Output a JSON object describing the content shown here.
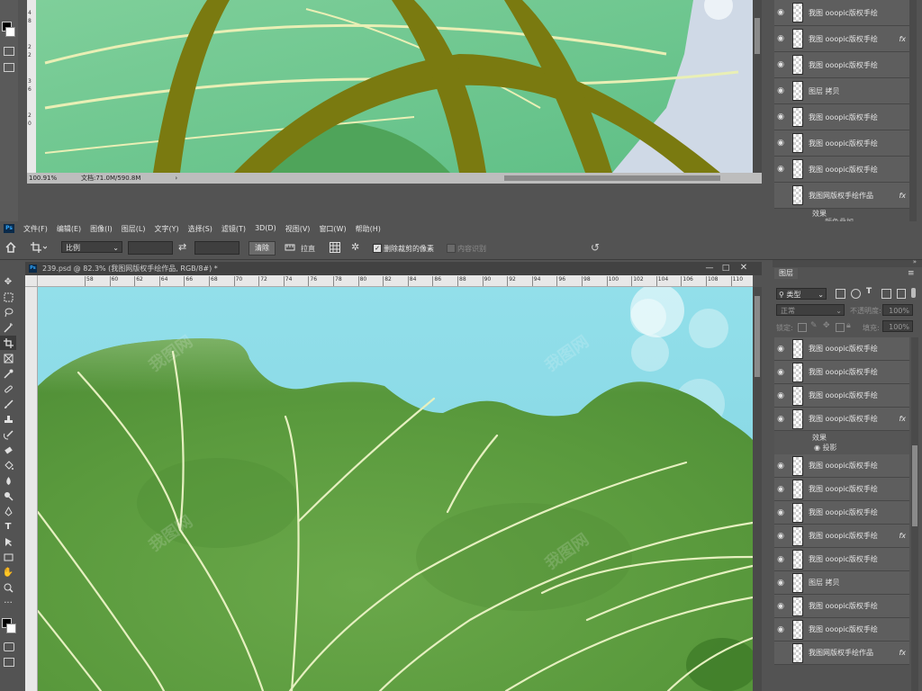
{
  "top_window": {
    "zoom": "100.91%",
    "doc_info": "文档:71.0M/590.8M",
    "ruler_marks": [
      "4",
      "8",
      "2",
      "2",
      "3",
      "6",
      "2",
      "0",
      "2",
      "4"
    ]
  },
  "menubar": {
    "ps_icon": "Ps",
    "items": [
      "文件(F)",
      "编辑(E)",
      "图像(I)",
      "图层(L)",
      "文字(Y)",
      "选择(S)",
      "滤镜(T)",
      "3D(D)",
      "视图(V)",
      "窗口(W)",
      "帮助(H)"
    ]
  },
  "options": {
    "ratio_value": "比例",
    "clear_button": "清除",
    "straighten": "拉直",
    "delete_cropped": "删除裁剪的像素",
    "content_aware": "内容识别"
  },
  "document": {
    "tab_title": "239.psd @ 82.3% (我图网版权手绘作品, RGB/8#) *",
    "ruler_h": [
      "58",
      "60",
      "62",
      "64",
      "66",
      "68",
      "70",
      "72",
      "74",
      "76",
      "78",
      "80",
      "82",
      "84",
      "86",
      "88",
      "90",
      "92",
      "94",
      "96",
      "98",
      "100",
      "102",
      "104",
      "106",
      "108",
      "110",
      "112"
    ]
  },
  "layers_panel": {
    "tab_label": "图层",
    "kind_label": "类型",
    "blend_mode": "正常",
    "opacity_label": "不透明度:",
    "opacity_value": "100%",
    "lock_label": "锁定:",
    "fill_label": "填充:",
    "fill_value": "100%",
    "effects_label": "效果",
    "shadow_label": "投影",
    "layers": [
      {
        "name": "我图 ooopic版权手绘",
        "fx": ""
      },
      {
        "name": "我图 ooopic版权手绘",
        "fx": ""
      },
      {
        "name": "我图 ooopic版权手绘",
        "fx": ""
      },
      {
        "name": "我图 ooopic版权手绘",
        "fx": "fx"
      },
      {
        "name": "我图 ooopic版权手绘",
        "fx": ""
      },
      {
        "name": "我图 ooopic版权手绘",
        "fx": ""
      },
      {
        "name": "我图 ooopic版权手绘",
        "fx": ""
      },
      {
        "name": "我图 ooopic版权手绘",
        "fx": "fx"
      },
      {
        "name": "我图 ooopic版权手绘",
        "fx": ""
      },
      {
        "name": "图层 拷贝",
        "fx": ""
      },
      {
        "name": "我图 ooopic版权手绘",
        "fx": ""
      },
      {
        "name": "我图 ooopic版权手绘",
        "fx": ""
      },
      {
        "name": "我图网版权手绘作品",
        "fx": "fx"
      }
    ]
  },
  "top_layers": {
    "layers": [
      {
        "name": "我图 ooopic版权手绘",
        "fx": ""
      },
      {
        "name": "我图 ooopic版权手绘",
        "fx": "fx"
      },
      {
        "name": "我图 ooopic版权手绘",
        "fx": ""
      },
      {
        "name": "图层 拷贝",
        "fx": ""
      },
      {
        "name": "我图 ooopic版权手绘",
        "fx": ""
      },
      {
        "name": "我图 ooopic版权手绘",
        "fx": ""
      },
      {
        "name": "我图 ooopic版权手绘",
        "fx": ""
      },
      {
        "name": "我图网版权手绘作品",
        "fx": "fx"
      }
    ],
    "effects_label": "效果",
    "sub_effect": "颜色叠加"
  },
  "watermark": "我图网",
  "colors": {
    "sky": "#8fdbe6",
    "leaf_green": "#5d9a3c",
    "stem_olive": "#7a7a10",
    "vein": "#e6f0c0"
  }
}
